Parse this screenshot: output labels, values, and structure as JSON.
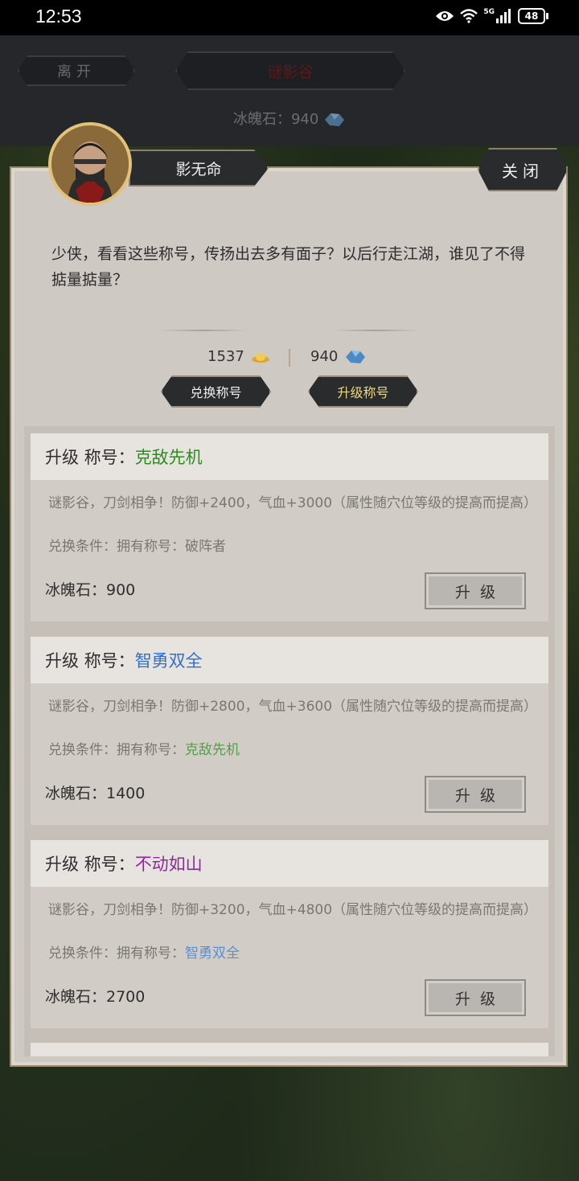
{
  "status": {
    "time": "12:53",
    "network": "5G",
    "battery": "48"
  },
  "header": {
    "leave_label": "离开",
    "location": "谜影谷",
    "stone_label": "冰魄石：940"
  },
  "npc": {
    "name": "影无命",
    "close_label": "关闭",
    "intro": "少侠，看看这些称号，传扬出去多有面子？以后行走江湖，谁见了不得掂量掂量？"
  },
  "currency": {
    "gold": "1537",
    "stone": "940"
  },
  "tabs": {
    "exchange": "兑换称号",
    "upgrade": "升级称号"
  },
  "cards": [
    {
      "prefix": "升级 称号：",
      "title": "克敌先机",
      "desc": "谜影谷，刀剑相争！防御+2400，气血+3000（属性随穴位等级的提高而提高）",
      "cond_prefix": "兑换条件：拥有称号：",
      "cond_title": "破阵者",
      "cost": "冰魄石：900",
      "button": "升级"
    },
    {
      "prefix": "升级 称号：",
      "title": "智勇双全",
      "desc": "谜影谷，刀剑相争！防御+2800，气血+3600（属性随穴位等级的提高而提高）",
      "cond_prefix": "兑换条件：拥有称号：",
      "cond_title": "克敌先机",
      "cost": "冰魄石：1400",
      "button": "升级"
    },
    {
      "prefix": "升级 称号：",
      "title": "不动如山",
      "desc": "谜影谷，刀剑相争！防御+3200，气血+4800（属性随穴位等级的提高而提高）",
      "cond_prefix": "兑换条件：拥有称号：",
      "cond_title": "智勇双全",
      "cost": "冰魄石：2700",
      "button": "升级"
    }
  ]
}
